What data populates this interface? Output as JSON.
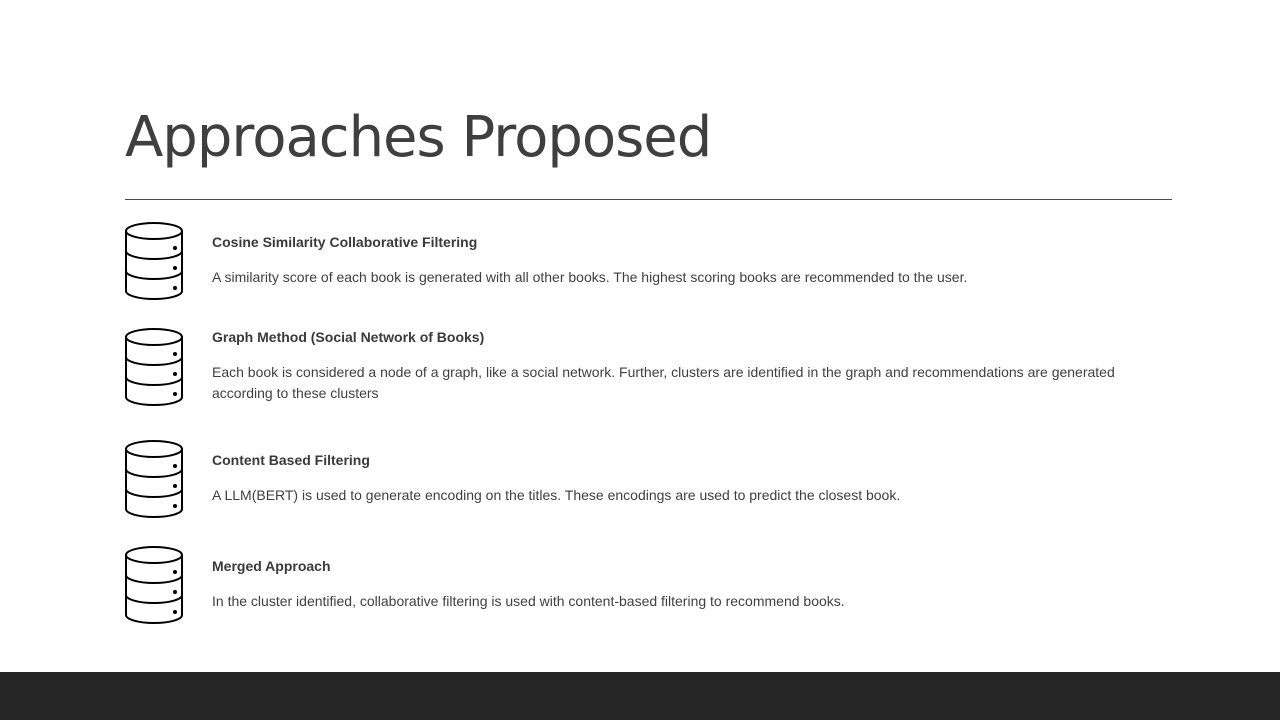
{
  "slide": {
    "title": "Approaches Proposed"
  },
  "items": [
    {
      "icon": "database-icon",
      "heading": "Cosine Similarity Collaborative Filtering",
      "description": "A similarity score of each book is generated with all other books. The highest scoring books are recommended to the user."
    },
    {
      "icon": "database-icon",
      "heading": "Graph Method (Social Network of Books)",
      "description": "Each book is considered a node of a graph, like a social network. Further, clusters are identified in the graph and recommendations are generated according to these clusters"
    },
    {
      "icon": "database-icon",
      "heading": "Content Based Filtering",
      "description": "A LLM(BERT) is used to generate encoding on the titles. These encodings are used to predict the closest book."
    },
    {
      "icon": "database-icon",
      "heading": "Merged Approach",
      "description": "In the cluster identified, collaborative filtering is used with content-based filtering to recommend books."
    }
  ],
  "colors": {
    "title": "#3f3f3f",
    "text": "#404040",
    "footer": "#262626",
    "background": "#ffffff"
  }
}
